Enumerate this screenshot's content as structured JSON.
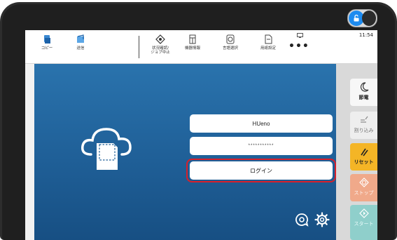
{
  "device": {
    "lock_toggle_state": "unlocked",
    "accent_color": "#1d8bf0"
  },
  "header": {
    "tools": [
      {
        "label": "コピー",
        "icon": "copy-icon"
      },
      {
        "label": "送信",
        "icon": "send-icon"
      },
      {
        "label": "状況確認/\nジョブ中止",
        "icon": "status-check-icon"
      },
      {
        "label": "機器情報",
        "icon": "device-info-icon"
      },
      {
        "label": "言語選択",
        "icon": "language-icon"
      },
      {
        "label": "用紙設定",
        "icon": "paper-settings-icon"
      }
    ],
    "more_label": "•••",
    "time": "11:54"
  },
  "login": {
    "username": "HUeno",
    "password_mask": "***********",
    "login_button": "ログイン",
    "highlight_color": "#d8202a"
  },
  "side_panel": {
    "sleep_label": "節電",
    "interrupt_label": "割り込み",
    "reset_label": "リセット",
    "stop_label": "ストップ",
    "start_label": "スタート",
    "reset_color": "#f4b526",
    "stop_color": "#f0a98a",
    "start_color": "#8fcfcb"
  }
}
